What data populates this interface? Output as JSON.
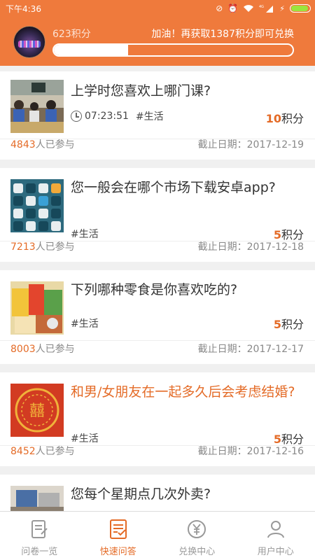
{
  "status_bar": {
    "time": "下午4:36",
    "network_label": "4G",
    "battery_level": 0.85
  },
  "header": {
    "points_label": "623积分",
    "encourage_text": "加油！再获取1387积分即可兑换",
    "progress_fraction": 0.31
  },
  "questions": [
    {
      "title": "上学时您喜欢上哪门课?",
      "time": "07:23:51",
      "tag": "#生活",
      "points_value": "10",
      "points_unit": "积分",
      "participants_count": "4843",
      "participants_suffix": "人已参与",
      "deadline": "截止日期：2017-12-19",
      "highlight": false,
      "thumb_icon": "classroom-photo"
    },
    {
      "title": "您一般会在哪个市场下载安卓app?",
      "tag": "#生活",
      "points_value": "5",
      "points_unit": "积分",
      "participants_count": "7213",
      "participants_suffix": "人已参与",
      "deadline": "截止日期：2017-12-18",
      "highlight": false,
      "thumb_icon": "app-icons-photo"
    },
    {
      "title": " 下列哪种零食是你喜欢吃的?",
      "tag": "#生活",
      "points_value": "5",
      "points_unit": "积分",
      "participants_count": "8003",
      "participants_suffix": "人已参与",
      "deadline": "截止日期：2017-12-17",
      "highlight": false,
      "thumb_icon": "snacks-photo"
    },
    {
      "title": "和男/女朋友在一起多久后会考虑结婚?",
      "tag": "#生活",
      "points_value": "5",
      "points_unit": "积分",
      "participants_count": "8452",
      "participants_suffix": "人已参与",
      "deadline": "截止日期：2017-12-16",
      "highlight": true,
      "thumb_icon": "wedding-photo"
    },
    {
      "title": "您每个星期点几次外卖?",
      "highlight": false,
      "thumb_icon": "takeout-photo"
    }
  ],
  "nav": {
    "items": [
      {
        "label": "问卷一览",
        "icon": "document-icon",
        "active": false
      },
      {
        "label": "快速问答",
        "icon": "checklist-icon",
        "active": true
      },
      {
        "label": "兑换中心",
        "icon": "yuan-icon",
        "active": false
      },
      {
        "label": "用户中心",
        "icon": "user-icon",
        "active": false
      }
    ]
  },
  "colors": {
    "accent": "#ef7a3c",
    "accent_text": "#e46b27",
    "inactive": "#999999"
  }
}
